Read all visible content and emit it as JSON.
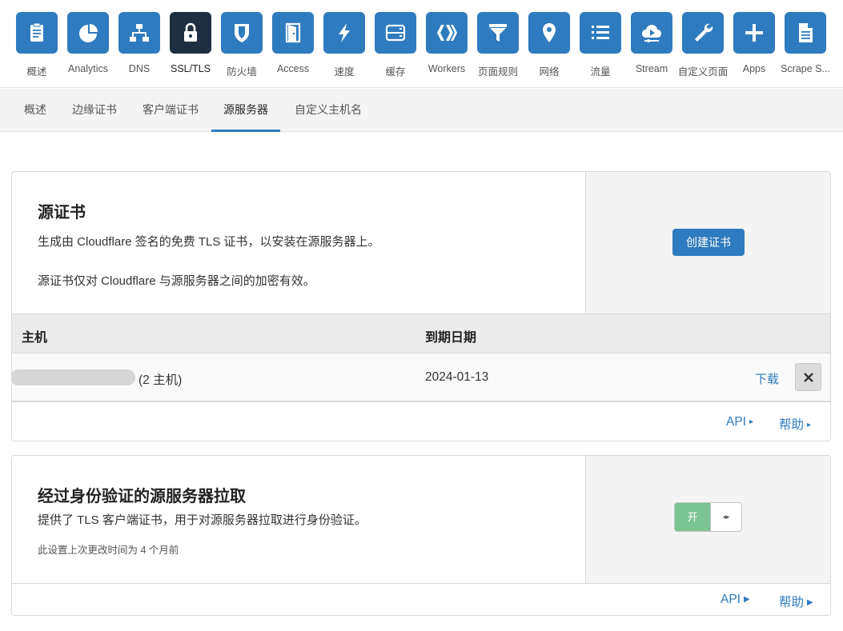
{
  "apps": [
    {
      "label": "概述",
      "icon": "clipboard-icon",
      "active": false
    },
    {
      "label": "Analytics",
      "icon": "pie-chart-icon",
      "active": false
    },
    {
      "label": "DNS",
      "icon": "network-icon",
      "active": false
    },
    {
      "label": "SSL/TLS",
      "icon": "lock-icon",
      "active": true
    },
    {
      "label": "防火墙",
      "icon": "shield-icon",
      "active": false
    },
    {
      "label": "Access",
      "icon": "door-icon",
      "active": false
    },
    {
      "label": "速度",
      "icon": "lightning-icon",
      "active": false
    },
    {
      "label": "缓存",
      "icon": "server-icon",
      "active": false
    },
    {
      "label": "Workers",
      "icon": "workers-icon",
      "active": false
    },
    {
      "label": "页面规则",
      "icon": "filter-icon",
      "active": false
    },
    {
      "label": "网络",
      "icon": "location-pin-icon",
      "active": false
    },
    {
      "label": "流量",
      "icon": "list-icon",
      "active": false
    },
    {
      "label": "Stream",
      "icon": "cloud-play-icon",
      "active": false
    },
    {
      "label": "自定义页面",
      "icon": "wrench-icon",
      "active": false
    },
    {
      "label": "Apps",
      "icon": "plus-icon",
      "active": false
    },
    {
      "label": "Scrape S...",
      "icon": "document-icon",
      "active": false
    }
  ],
  "subtabs": [
    {
      "label": "概述",
      "active": false
    },
    {
      "label": "边缘证书",
      "active": false
    },
    {
      "label": "客户端证书",
      "active": false
    },
    {
      "label": "源服务器",
      "active": true
    },
    {
      "label": "自定义主机名",
      "active": false
    }
  ],
  "origin_cert": {
    "title": "源证书",
    "desc1": "生成由 Cloudflare 签名的免费 TLS 证书，以安装在源服务器上。",
    "desc2": "源证书仅对 Cloudflare 与源服务器之间的加密有效。",
    "create_button": "创建证书",
    "table": {
      "col_host": "主机",
      "col_expiry": "到期日期",
      "rows": [
        {
          "hosts": "(2 主机)",
          "expiry": "2024-01-13",
          "download": "下载"
        }
      ]
    },
    "api_link": "API",
    "help_link": "帮助"
  },
  "auth_pull": {
    "title": "经过身份验证的源服务器拉取",
    "desc": "提供了 TLS 客户端证书，用于对源服务器拉取进行身份验证。",
    "last_changed": "此设置上次更改时间为 4 个月前",
    "toggle_on_label": "开",
    "toggle_state": "on",
    "api_link": "API",
    "help_link": "帮助"
  },
  "colors": {
    "accent": "#2f7bbf",
    "active_tile": "#1e2f41",
    "toggle_on": "#7bc493"
  }
}
